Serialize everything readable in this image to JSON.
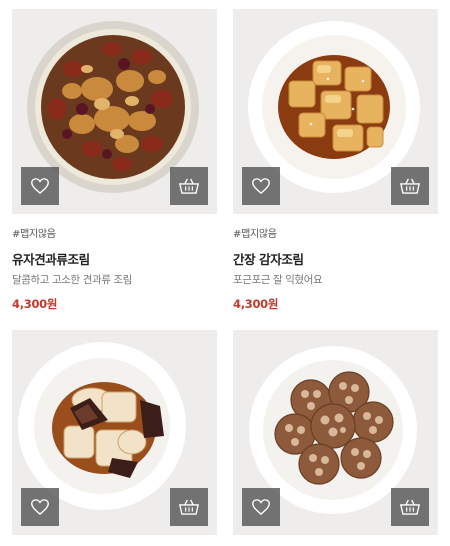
{
  "products": [
    {
      "tag": "#맵지않음",
      "title": "유자견과류조림",
      "description": "달콤하고 고소한 견과류 조림",
      "price": "4,300원",
      "icons": {
        "like": "heart-icon",
        "cart": "basket-icon"
      }
    },
    {
      "tag": "#맵지않음",
      "title": "간장 감자조림",
      "description": "포근포근 잘 익혔어요",
      "price": "4,300원",
      "icons": {
        "like": "heart-icon",
        "cart": "basket-icon"
      }
    },
    {
      "tag": "",
      "title": "",
      "description": "",
      "price": "",
      "icons": {
        "like": "heart-icon",
        "cart": "basket-icon"
      }
    },
    {
      "tag": "",
      "title": "",
      "description": "",
      "price": "",
      "icons": {
        "like": "heart-icon",
        "cart": "basket-icon"
      }
    }
  ],
  "colors": {
    "price": "#c0392b",
    "thumb_bg": "#eeedeb",
    "button_bg": "#505050"
  }
}
